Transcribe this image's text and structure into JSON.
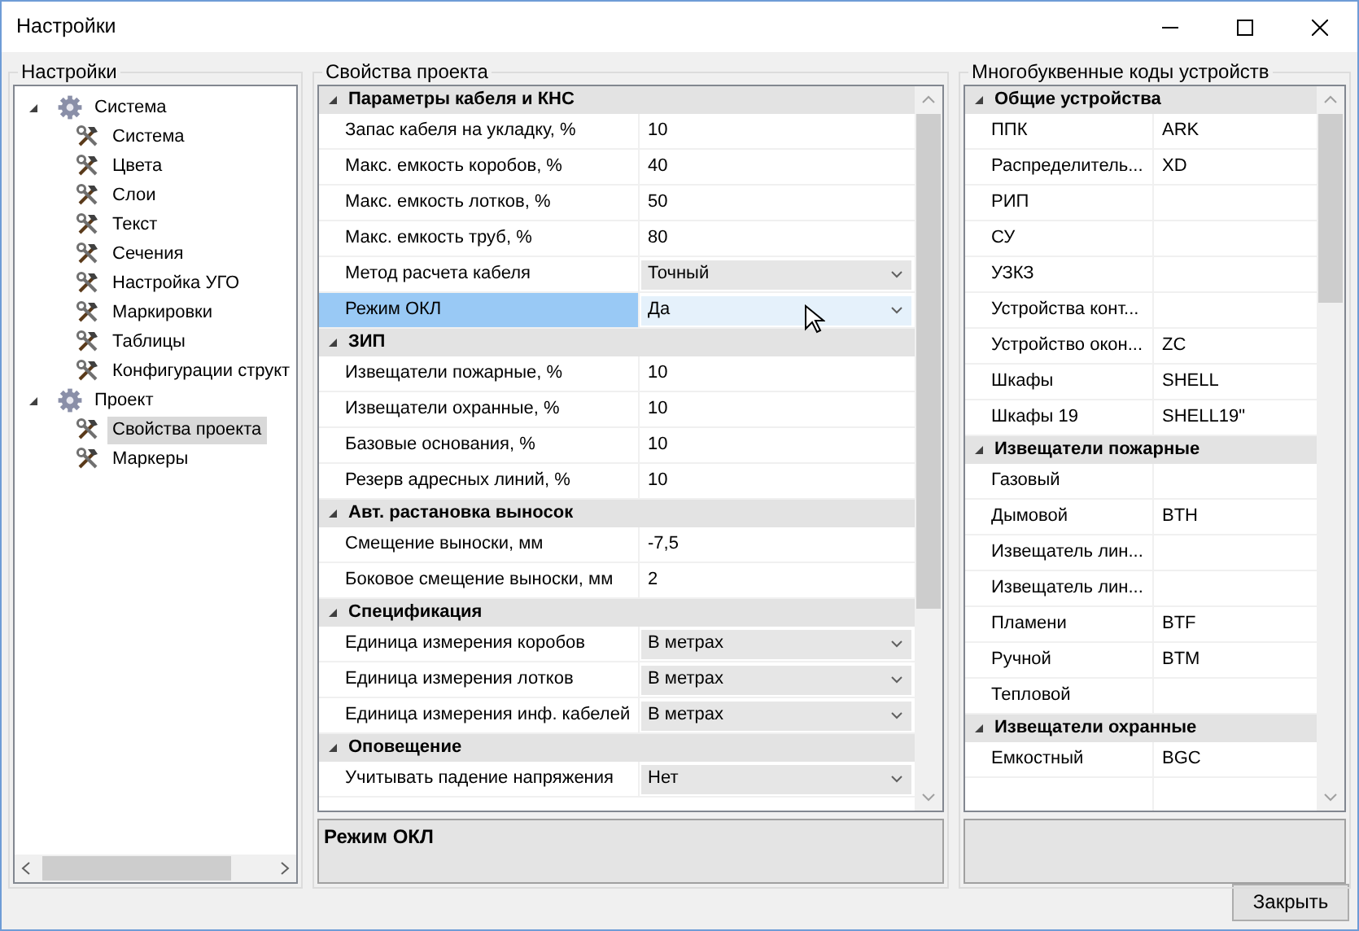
{
  "window": {
    "title": "Настройки"
  },
  "settings_tree": {
    "title": "Настройки",
    "items": [
      {
        "label": "Система",
        "kind": "group",
        "expanded": true,
        "selected": false,
        "children": [
          {
            "label": "Система",
            "kind": "item",
            "selected": false
          },
          {
            "label": "Цвета",
            "kind": "item",
            "selected": false
          },
          {
            "label": "Слои",
            "kind": "item",
            "selected": false
          },
          {
            "label": "Текст",
            "kind": "item",
            "selected": false
          },
          {
            "label": "Сечения",
            "kind": "item",
            "selected": false
          },
          {
            "label": "Настройка УГО",
            "kind": "item",
            "selected": false
          },
          {
            "label": "Маркировки",
            "kind": "item",
            "selected": false
          },
          {
            "label": "Таблицы",
            "kind": "item",
            "selected": false
          },
          {
            "label": "Конфигурации структ",
            "kind": "item",
            "selected": false
          }
        ]
      },
      {
        "label": "Проект",
        "kind": "group",
        "expanded": true,
        "selected": false,
        "children": [
          {
            "label": "Свойства проекта",
            "kind": "item",
            "selected": true
          },
          {
            "label": "Маркеры",
            "kind": "item",
            "selected": false
          }
        ]
      }
    ]
  },
  "project_properties": {
    "title": "Свойства проекта",
    "categories": [
      {
        "title": "Параметры кабеля и КНС",
        "expanded": true,
        "rows": [
          {
            "label": "Запас кабеля на укладку, %",
            "value": "10",
            "kind": "text",
            "selected": false
          },
          {
            "label": "Макс. емкость коробов, %",
            "value": "40",
            "kind": "text",
            "selected": false
          },
          {
            "label": "Макс. емкость лотков, %",
            "value": "50",
            "kind": "text",
            "selected": false
          },
          {
            "label": "Макс. емкость труб, %",
            "value": "80",
            "kind": "text",
            "selected": false
          },
          {
            "label": "Метод расчета кабеля",
            "value": "Точный",
            "kind": "dropdown",
            "selected": false
          },
          {
            "label": "Режим ОКЛ",
            "value": "Да",
            "kind": "dropdown",
            "selected": true
          }
        ]
      },
      {
        "title": "ЗИП",
        "expanded": true,
        "rows": [
          {
            "label": "Извещатели пожарные, %",
            "value": "10",
            "kind": "text",
            "selected": false
          },
          {
            "label": "Извещатели охранные, %",
            "value": "10",
            "kind": "text",
            "selected": false
          },
          {
            "label": "Базовые основания, %",
            "value": "10",
            "kind": "text",
            "selected": false
          },
          {
            "label": "Резерв адресных линий, %",
            "value": "10",
            "kind": "text",
            "selected": false
          }
        ]
      },
      {
        "title": "Авт. растановка выносок",
        "expanded": true,
        "rows": [
          {
            "label": "Смещение выноски, мм",
            "value": "-7,5",
            "kind": "text",
            "selected": false
          },
          {
            "label": "Боковое смещение выноски, мм",
            "value": "2",
            "kind": "text",
            "selected": false
          }
        ]
      },
      {
        "title": "Спецификация",
        "expanded": true,
        "rows": [
          {
            "label": "Единица измерения коробов",
            "value": "В метрах",
            "kind": "dropdown",
            "selected": false
          },
          {
            "label": "Единица измерения лотков",
            "value": "В метрах",
            "kind": "dropdown",
            "selected": false
          },
          {
            "label": "Единица измерения инф. кабелей",
            "value": "В метрах",
            "kind": "dropdown",
            "selected": false
          }
        ]
      },
      {
        "title": "Оповещение",
        "expanded": true,
        "rows": [
          {
            "label": "Учитывать падение напряжения",
            "value": "Нет",
            "kind": "dropdown",
            "selected": false
          }
        ]
      }
    ],
    "description": {
      "title": "Режим ОКЛ"
    }
  },
  "device_codes": {
    "title": "Многобуквенные коды устройств",
    "categories": [
      {
        "title": "Общие устройства",
        "expanded": true,
        "rows": [
          {
            "label": "ППК",
            "value": "ARK"
          },
          {
            "label": "Распределитель...",
            "value": "XD"
          },
          {
            "label": "РИП"
          },
          {
            "label": "СУ"
          },
          {
            "label": "УЗКЗ"
          },
          {
            "label": "Устройства конт..."
          },
          {
            "label": "Устройство окон...",
            "value": "ZC"
          },
          {
            "label": "Шкафы",
            "value": "SHELL"
          },
          {
            "label": "Шкафы 19",
            "value": "SHELL19\""
          }
        ]
      },
      {
        "title": "Извещатели пожарные",
        "expanded": true,
        "rows": [
          {
            "label": "Газовый"
          },
          {
            "label": "Дымовой",
            "value": "BTH"
          },
          {
            "label": "Извещатель лин..."
          },
          {
            "label": "Извещатель лин..."
          },
          {
            "label": "Пламени",
            "value": "BTF"
          },
          {
            "label": "Ручной",
            "value": "BTM"
          },
          {
            "label": "Тепловой"
          }
        ]
      },
      {
        "title": "Извещатели охранные",
        "expanded": true,
        "rows": [
          {
            "label": "Емкостный",
            "value": "BGC"
          },
          {
            "label": ""
          }
        ]
      }
    ]
  },
  "buttons": [
    {
      "label": "Закрыть"
    }
  ]
}
